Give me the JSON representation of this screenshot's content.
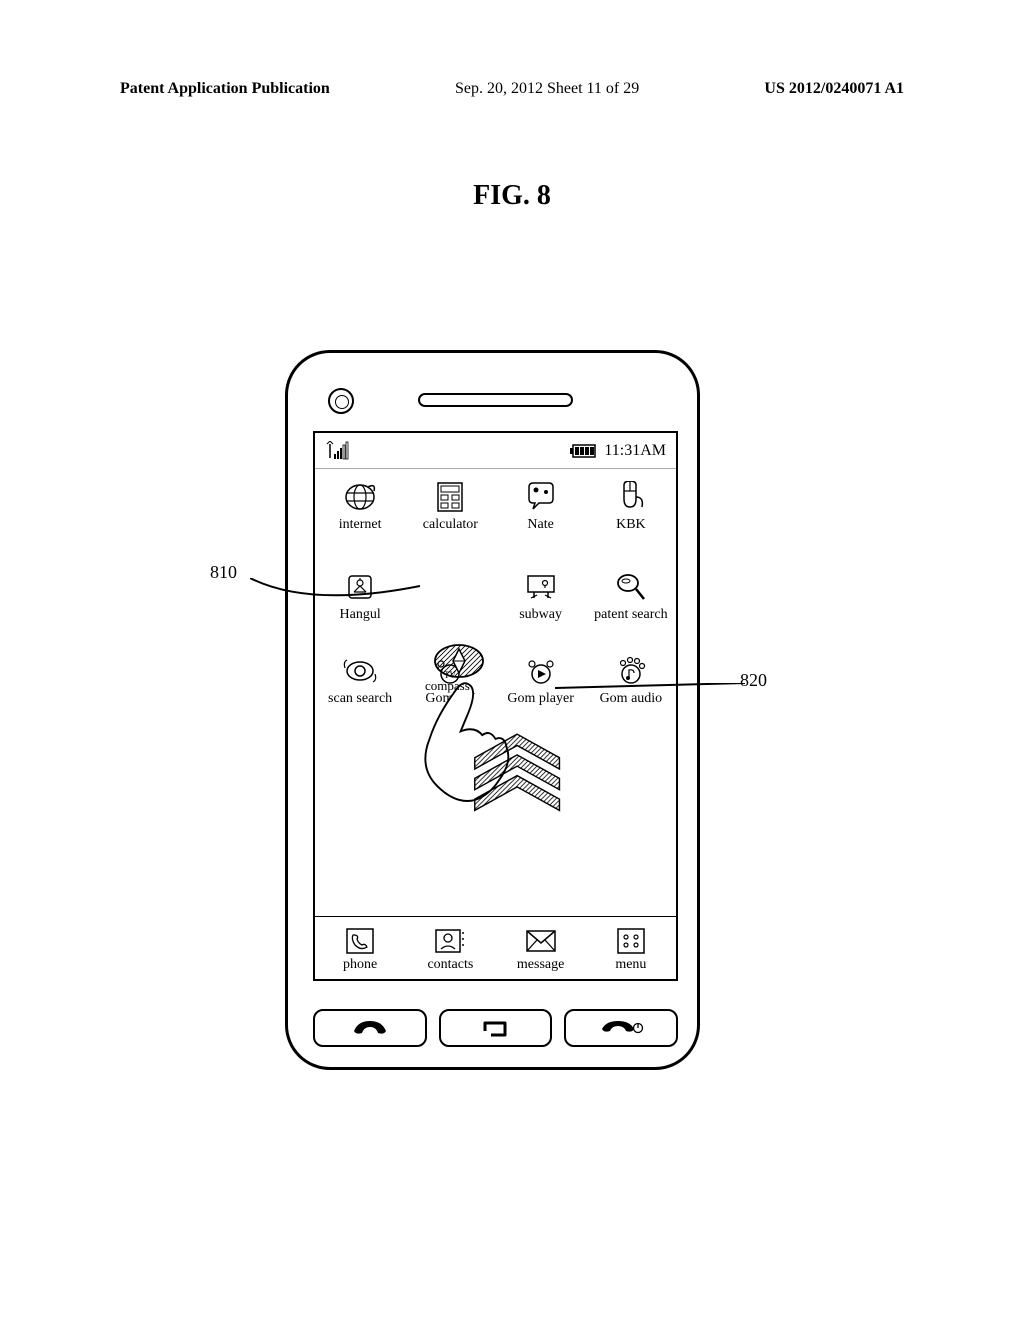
{
  "header": {
    "left": "Patent Application Publication",
    "mid": "Sep. 20, 2012  Sheet 11 of 29",
    "right": "US 2012/0240071 A1"
  },
  "figure_title": "FIG. 8",
  "callouts": {
    "c810": "810",
    "c820": "820"
  },
  "status": {
    "time": "11:31AM"
  },
  "apps": {
    "row1": [
      {
        "label": "internet"
      },
      {
        "label": "calculator"
      },
      {
        "label": "Nate"
      },
      {
        "label": "KBK"
      }
    ],
    "row2": [
      {
        "label": "Hangul"
      },
      {
        "label": ""
      },
      {
        "label": "subway"
      },
      {
        "label": "patent search"
      }
    ],
    "row3": [
      {
        "label": "scan search"
      },
      {
        "label": "Gom TV"
      },
      {
        "label": "Gom player"
      },
      {
        "label": "Gom audio"
      }
    ],
    "compass_label": "compass"
  },
  "dock": [
    {
      "label": "phone"
    },
    {
      "label": "contacts"
    },
    {
      "label": "message"
    },
    {
      "label": "menu"
    }
  ]
}
